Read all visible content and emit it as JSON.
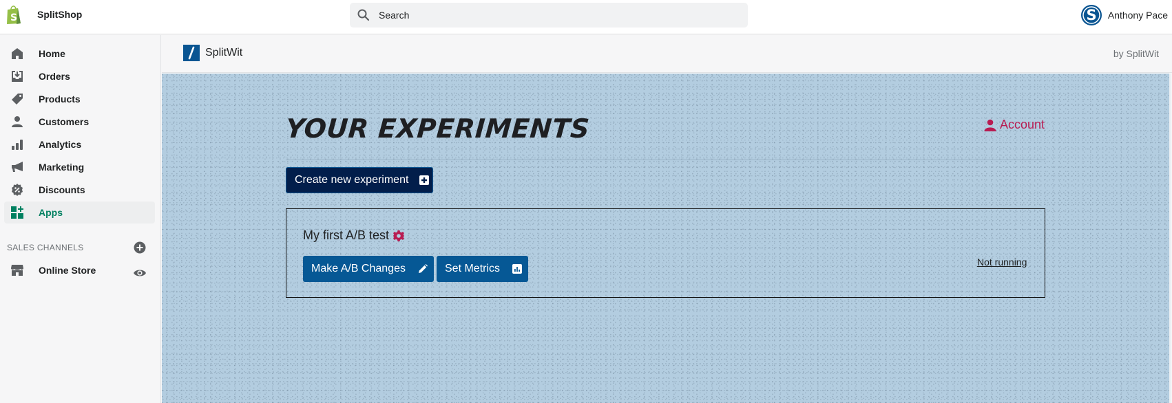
{
  "topbar": {
    "store_name": "SplitShop",
    "search_placeholder": "Search",
    "user_name": "Anthony Pace"
  },
  "sidebar": {
    "items": [
      {
        "label": "Home",
        "icon": "home-icon"
      },
      {
        "label": "Orders",
        "icon": "orders-icon"
      },
      {
        "label": "Products",
        "icon": "tag-icon"
      },
      {
        "label": "Customers",
        "icon": "person-icon"
      },
      {
        "label": "Analytics",
        "icon": "bar-chart-icon"
      },
      {
        "label": "Marketing",
        "icon": "megaphone-icon"
      },
      {
        "label": "Discounts",
        "icon": "discount-icon"
      },
      {
        "label": "Apps",
        "icon": "apps-icon",
        "active": true
      }
    ],
    "sales_channels_title": "SALES CHANNELS",
    "channels": [
      {
        "label": "Online Store",
        "icon": "store-icon"
      }
    ]
  },
  "app_header": {
    "app_name": "SplitWit",
    "by_label": "by SplitWit"
  },
  "main": {
    "page_title": "YOUR EXPERIMENTS",
    "account_label": "Account",
    "create_button_label": "Create new experiment",
    "experiments": [
      {
        "name": "My first A/B test",
        "make_changes_label": "Make A/B Changes",
        "set_metrics_label": "Set Metrics",
        "status": "Not running"
      }
    ]
  },
  "colors": {
    "shopify_green": "#95bf47",
    "active_green": "#008060",
    "accent_crimson": "#b81c52",
    "button_blue": "#065895",
    "button_navy": "#021e4b",
    "content_bg": "#b3cde0"
  }
}
